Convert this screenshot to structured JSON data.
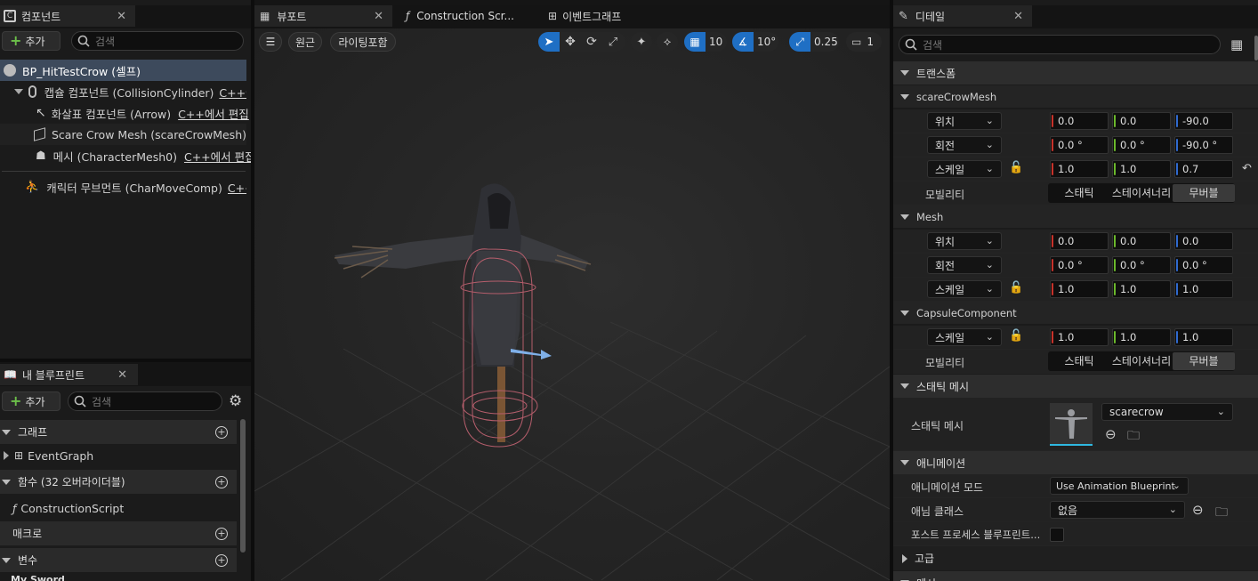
{
  "components_panel": {
    "tab_title": "컴포넌트",
    "add_label": "추가",
    "search_placeholder": "검색",
    "tree": [
      {
        "label": "BP_HitTestCrow (셀프)",
        "suffix": ""
      },
      {
        "label": "캡슐 컴포넌트 (CollisionCylinder)",
        "suffix": "C++에서 편집"
      },
      {
        "label": "화살표 컴포넌트 (Arrow)",
        "suffix": "C++에서 편집"
      },
      {
        "label": "Scare Crow Mesh (scareCrowMesh)",
        "suffix": ""
      },
      {
        "label": "메시 (CharacterMesh0)",
        "suffix": "C++에서 편집"
      },
      {
        "label": "캐릭터 무브먼트 (CharMoveComp)",
        "suffix": "C++에서 편집"
      }
    ]
  },
  "blueprint_panel": {
    "tab_title": "내 블루프린트",
    "add_label": "추가",
    "search_placeholder": "검색",
    "sections": {
      "graph": "그래프",
      "event_graph": "EventGraph",
      "functions": "함수 (32 오버라이더블)",
      "construction_script": "ConstructionScript",
      "macros": "매크로",
      "variables": "변수",
      "var_category": "My Sword"
    }
  },
  "viewport": {
    "tabs": {
      "viewport": "뷰포트",
      "construction": "Construction Scr...",
      "event_graph": "이벤트그래프"
    },
    "toolbar": {
      "perspective": "원근",
      "lighting": "라이팅포함",
      "grid_snap": "10",
      "rot_snap": "10°",
      "scale_snap": "0.25",
      "camera_speed": "1"
    }
  },
  "details": {
    "tab_title": "디테일",
    "search_placeholder": "검색",
    "transform_header": "트랜스폼",
    "location": "위치",
    "rotation": "회전",
    "scale": "스케일",
    "mobility": "모빌리티",
    "mobility_options": [
      "스태틱",
      "스테이셔너리",
      "무버블"
    ],
    "scarecrow": {
      "name": "scareCrowMesh",
      "location": [
        "0.0",
        "0.0",
        "-90.0"
      ],
      "rotation": [
        "0.0 °",
        "0.0 °",
        "-90.0 °"
      ],
      "scale": [
        "1.0",
        "1.0",
        "0.7"
      ]
    },
    "mesh": {
      "name": "Mesh",
      "location": [
        "0.0",
        "0.0",
        "0.0"
      ],
      "rotation": [
        "0.0 °",
        "0.0 °",
        "0.0 °"
      ],
      "scale": [
        "1.0",
        "1.0",
        "1.0"
      ]
    },
    "capsule": {
      "name": "CapsuleComponent",
      "scale": [
        "1.0",
        "1.0",
        "1.0"
      ]
    },
    "static_mesh_header": "스태틱 메시",
    "static_mesh_label": "스태틱 메시",
    "static_mesh_value": "scarecrow",
    "animation_header": "애니메이션",
    "anim_mode_label": "애니메이션 모드",
    "anim_mode_value": "Use Animation Blueprint",
    "anim_class_label": "애님 클래스",
    "anim_class_value": "없음",
    "post_process_label": "포스트 프로세스 블루프린트...",
    "advanced_label": "고급",
    "next_header": "메시"
  },
  "colors": {
    "accent": "#1f6fc4",
    "selected_row": "#3d4a5c"
  }
}
